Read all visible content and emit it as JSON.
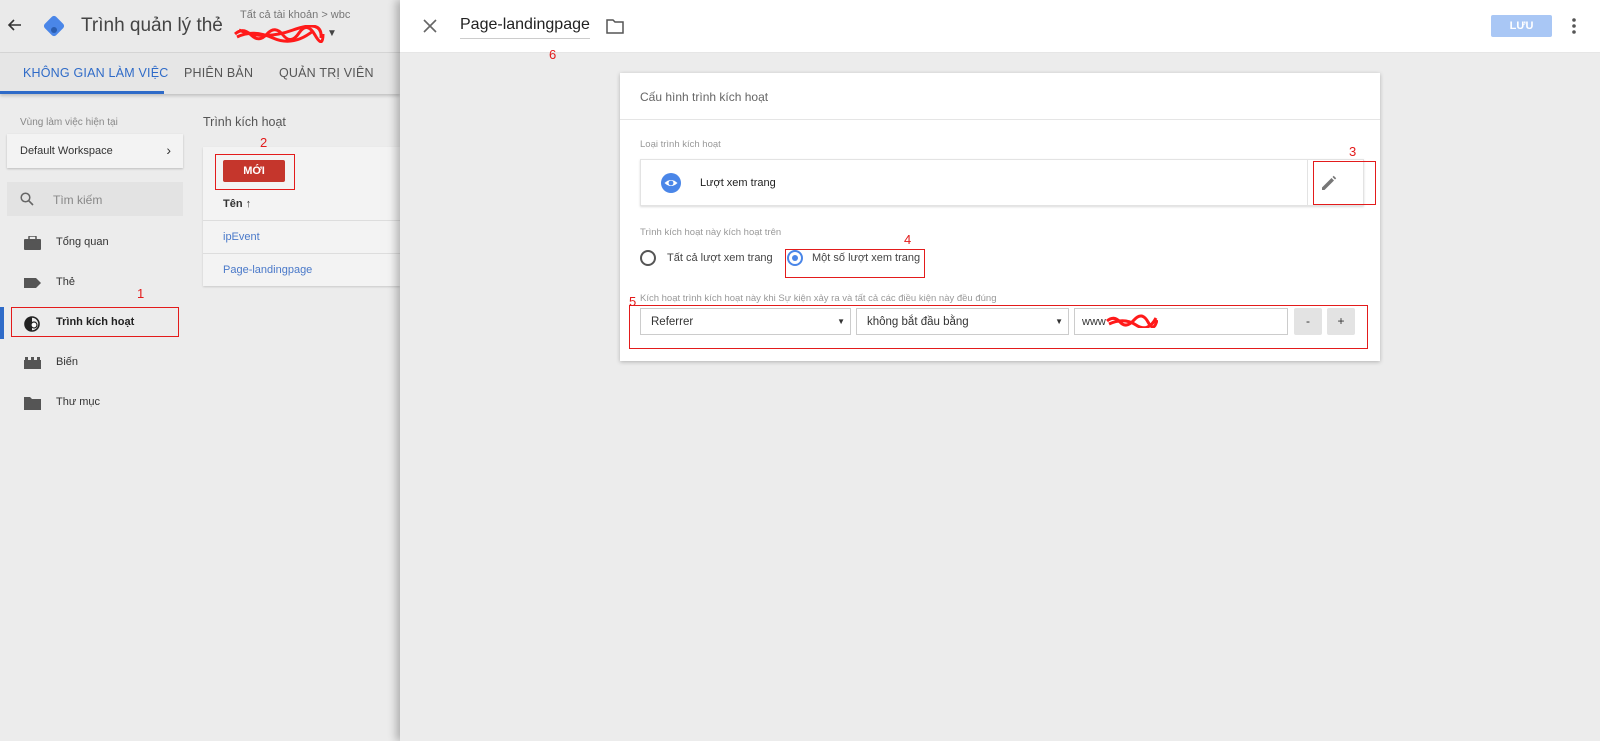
{
  "bg_app": {
    "title": "Trình quản lý thẻ",
    "breadcrumb": "Tất cả tài khoản > wbc",
    "tabs": [
      {
        "label": "KHÔNG GIAN LÀM VIỆC",
        "active": true
      },
      {
        "label": "PHIÊN BẢN",
        "active": false
      },
      {
        "label": "QUẢN TRỊ VIÊN",
        "active": false
      }
    ],
    "workspace_label": "Vùng làm việc hiện tại",
    "workspace_name": "Default Workspace",
    "search_placeholder": "Tìm kiếm",
    "nav": [
      {
        "label": "Tổng quan",
        "icon": "briefcase-icon"
      },
      {
        "label": "Thẻ",
        "icon": "tag-icon"
      },
      {
        "label": "Trình kích hoạt",
        "icon": "trigger-icon",
        "active": true
      },
      {
        "label": "Biến",
        "icon": "variable-icon"
      },
      {
        "label": "Thư mục",
        "icon": "folder-icon"
      }
    ],
    "triggers_title": "Trình kích hoạt",
    "new_button": "MỚI",
    "column_name": "Tên ↑",
    "rows": [
      "ipEvent",
      "Page-landingpage"
    ]
  },
  "overlay": {
    "title": "Page-landingpage",
    "save_label": "LƯU",
    "card_title": "Cấu hình trình kích hoạt",
    "type_label": "Loại trình kích hoạt",
    "type_name": "Lượt xem trang",
    "fires_on_label": "Trình kích hoạt này kích hoạt trên",
    "radio_all": "Tất cả lượt xem trang",
    "radio_some": "Một số lượt xem trang",
    "condition_label": "Kích hoạt trình kích hoạt này khi Sự kiện xảy ra và tất cả các điều kiện này đều đúng",
    "condition_variable": "Referrer",
    "condition_operator": "không bắt đầu bằng",
    "condition_value": "www",
    "minus_label": "-",
    "plus_label": "+"
  },
  "annotations": [
    "1",
    "2",
    "3",
    "4",
    "5",
    "6"
  ],
  "colors": {
    "accent": "#2f6bc8",
    "new_button": "#c5362c",
    "save_button": "#a9c7f5",
    "annotation": "#e31b1b"
  }
}
